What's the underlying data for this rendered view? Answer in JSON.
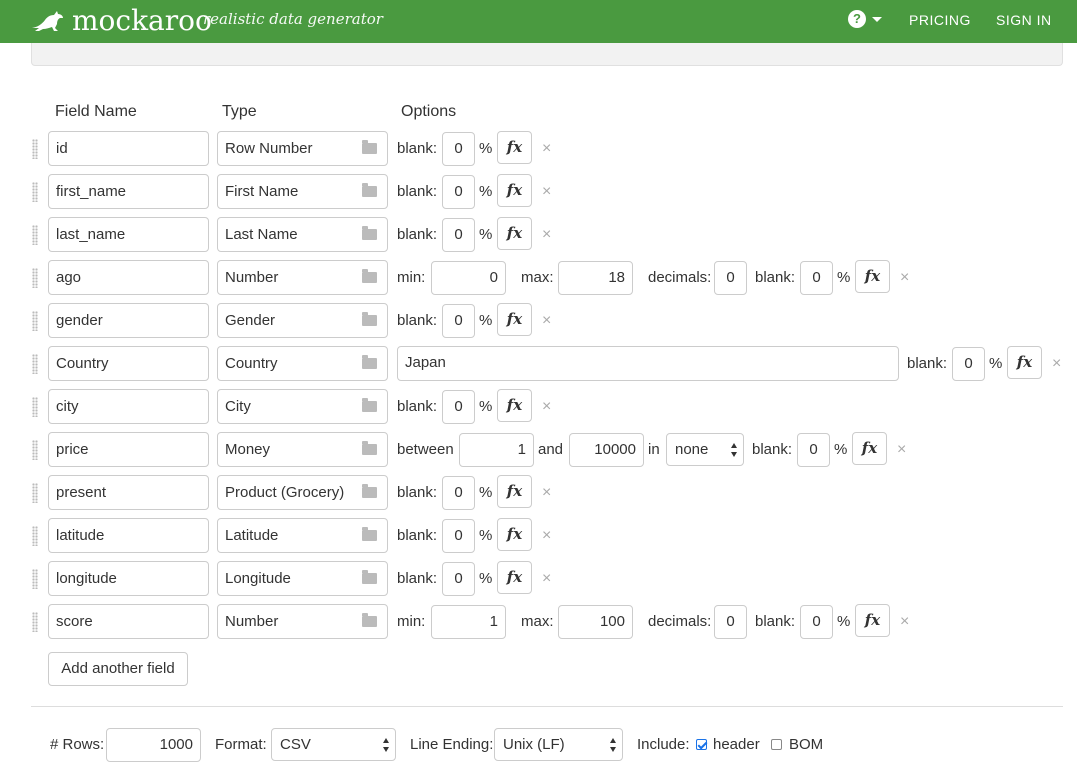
{
  "app": {
    "brand": "mockaroo",
    "tagline": "realistic data generator",
    "nav": {
      "help_icon": "question-circle-icon",
      "pricing": "PRICING",
      "sign_in": "SIGN IN"
    },
    "colors": {
      "navbar": "#4a9a40",
      "checkbox_accent": "#1a73e8"
    }
  },
  "schema": {
    "headers": {
      "field_name": "Field Name",
      "type": "Type",
      "options": "Options"
    },
    "labels": {
      "blank": "blank:",
      "percent": "%",
      "min": "min:",
      "max": "max:",
      "decimals": "decimals:",
      "between": "between",
      "and": "and",
      "in": "in",
      "fx": "fx",
      "delete": "×"
    },
    "fields": [
      {
        "name": "id",
        "type": "Row Number",
        "blank": "0"
      },
      {
        "name": "first_name",
        "type": "First Name",
        "blank": "0"
      },
      {
        "name": "last_name",
        "type": "Last Name",
        "blank": "0"
      },
      {
        "name": "ago",
        "type": "Number",
        "min": "0",
        "max": "18",
        "decimals": "0",
        "blank": "0"
      },
      {
        "name": "gender",
        "type": "Gender",
        "blank": "0"
      },
      {
        "name": "Country",
        "type": "Country",
        "value": "Japan",
        "blank": "0"
      },
      {
        "name": "city",
        "type": "City",
        "blank": "0"
      },
      {
        "name": "price",
        "type": "Money",
        "between": "1",
        "and": "10000",
        "currency": "none",
        "blank": "0"
      },
      {
        "name": "present",
        "type": "Product (Grocery)",
        "blank": "0"
      },
      {
        "name": "latitude",
        "type": "Latitude",
        "blank": "0"
      },
      {
        "name": "longitude",
        "type": "Longitude",
        "blank": "0"
      },
      {
        "name": "score",
        "type": "Number",
        "min": "1",
        "max": "100",
        "decimals": "0",
        "blank": "0"
      }
    ],
    "add_field_label": "Add another field"
  },
  "footer": {
    "rows_label": "# Rows:",
    "rows_value": "1000",
    "format_label": "Format:",
    "format_value": "CSV",
    "line_ending_label": "Line Ending:",
    "line_ending_value": "Unix (LF)",
    "include_label": "Include:",
    "header_label": "header",
    "header_checked": true,
    "bom_label": "BOM",
    "bom_checked": false
  }
}
